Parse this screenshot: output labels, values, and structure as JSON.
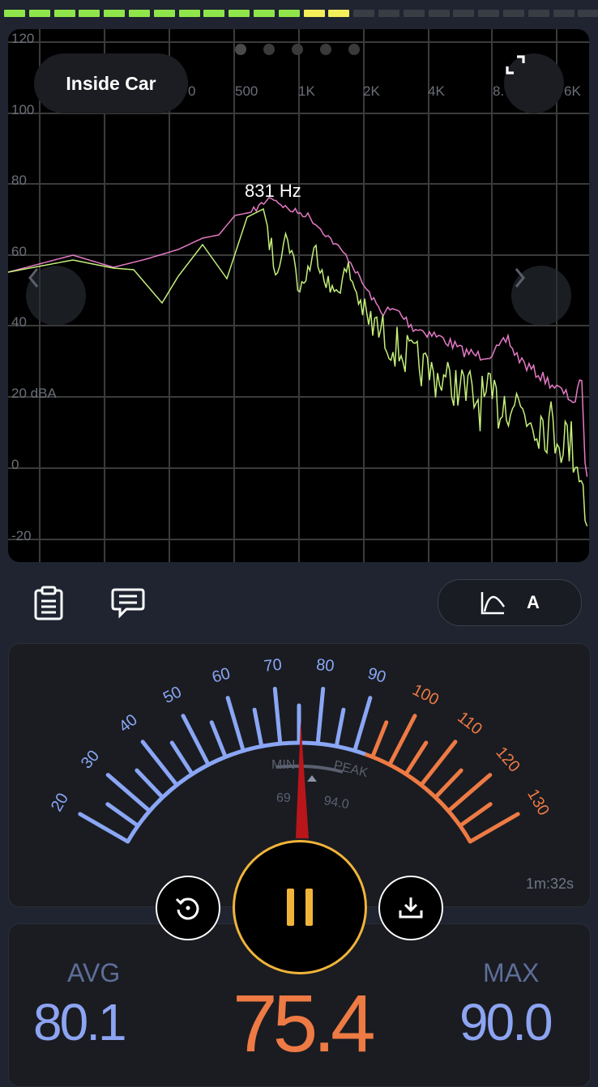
{
  "level_meter": {
    "segments": [
      "green",
      "green",
      "green",
      "green",
      "green",
      "green",
      "green",
      "green",
      "green",
      "green",
      "green",
      "green",
      "yellow",
      "yellow",
      "off",
      "off",
      "off",
      "off",
      "off",
      "off",
      "off",
      "off",
      "off",
      "off"
    ],
    "colors": {
      "green": "#8fe64a",
      "yellow": "#f4ee5a",
      "off": "#3a3d44"
    }
  },
  "spectrum": {
    "preset_label": "Inside Car",
    "peak_label": "831 Hz",
    "freq_labels": [
      "0",
      "500",
      "1K",
      "2K",
      "4K",
      "8.",
      "6K"
    ],
    "db_labels": [
      "120",
      "100",
      "80",
      "60",
      "40",
      "20 dBA",
      "0",
      "-20"
    ],
    "page_dots": 5,
    "active_page": 0,
    "colors": {
      "max_trace": "#e57ac6",
      "live_trace": "#c4ef7a",
      "grid": "#3b3b3b"
    }
  },
  "toolbar": {
    "weighting_label": "A"
  },
  "meter": {
    "scale_labels_blue": [
      "20",
      "30",
      "40",
      "50",
      "60",
      "70",
      "80",
      "90"
    ],
    "scale_labels_orange": [
      "100",
      "110",
      "120",
      "130"
    ],
    "min_label": "MIN",
    "peak_label": "PEAK",
    "min_value": "69",
    "peak_value": "94.0",
    "elapsed": "1m:32s",
    "colors": {
      "blue": "#8aa6f5",
      "orange": "#ee7a44",
      "needle": "#b8161a"
    }
  },
  "stats": {
    "avg_label": "AVG",
    "avg_value": "80.1",
    "current_value": "75.4",
    "max_label": "MAX",
    "max_value": "90.0"
  },
  "controls": {
    "reset_icon": "reset-icon",
    "pause_icon": "pause-icon",
    "download_icon": "download-icon"
  }
}
